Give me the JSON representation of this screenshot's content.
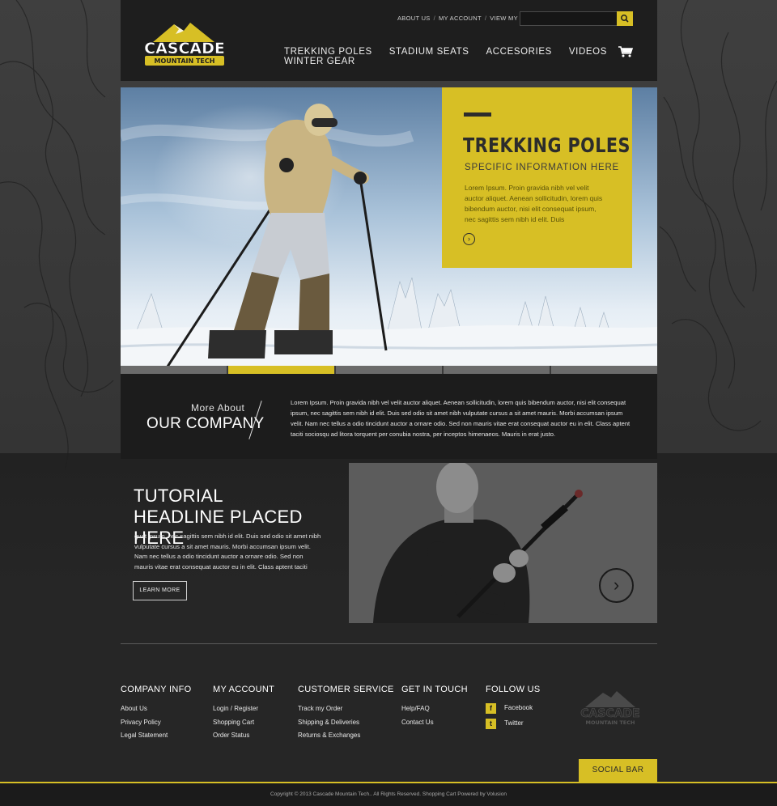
{
  "header": {
    "logo": {
      "name": "CASCADE",
      "tagline": "MOUNTAIN TECH"
    },
    "util_links": [
      "ABOUT US",
      "MY ACCOUNT",
      "VIEW MY CART"
    ],
    "search": {
      "placeholder": ""
    },
    "nav": [
      "TREKKING POLES",
      "STADIUM SEATS",
      "ACCESORIES",
      "VIDEOS",
      "WINTER GEAR"
    ],
    "cart_icon": "shopping-cart-icon",
    "search_icon": "search-icon"
  },
  "hero": {
    "title": "TREKKING POLES",
    "subtitle": "SPECIFIC INFORMATION HERE",
    "body": "Lorem Ipsum. Proin gravida nibh vel velit auctor aliquet. Aenean sollicitudin, lorem quis bibendum auctor, nisi elit consequat ipsum, nec sagittis sem nibh id elit. Duis",
    "arrow_icon": "chevron-right-icon",
    "slides": 5,
    "active_slide": 1
  },
  "about": {
    "kicker": "More About",
    "heading": "OUR COMPANY",
    "body": "Lorem Ipsum. Proin gravida nibh vel velit auctor aliquet. Aenean sollicitudin, lorem quis bibendum auctor, nisi elit consequat ipsum, nec sagittis sem nibh id elit. Duis sed odio sit amet nibh vulputate cursus a sit amet mauris. Morbi accumsan ipsum velit. Nam nec tellus a odio tincidunt auctor a ornare odio. Sed non  mauris vitae erat consequat auctor eu in elit. Class aptent taciti sociosqu ad litora torquent per conubia nostra, per inceptos himenaeos. Mauris in erat justo."
  },
  "tutorial": {
    "headline": "TUTORIAL HEADLINE PLACED HERE",
    "body": "quat ipsum, nec sagittis sem nibh id elit. Duis sed odio sit amet nibh vulputate cursus a sit amet mauris. Morbi accumsan ipsum velit. Nam nec tellus a odio tincidunt auctor a ornare odio. Sed non mauris vitae erat consequat auctor eu in elit. Class aptent taciti",
    "button": "LEARN MORE",
    "play_icon": "chevron-right-icon"
  },
  "footer": {
    "columns": [
      {
        "title": "COMPANY INFO",
        "links": [
          "About Us",
          "Privacy Policy",
          "Legal Statement"
        ]
      },
      {
        "title": "MY ACCOUNT",
        "links": [
          "Login / Register",
          "Shopping Cart",
          "Order Status"
        ]
      },
      {
        "title": "CUSTOMER SERVICE",
        "links": [
          "Track my Order",
          "Shipping & Deliveries",
          "Returns & Exchanges"
        ]
      },
      {
        "title": "GET IN TOUCH",
        "links": [
          "Help/FAQ",
          "Contact Us"
        ]
      }
    ],
    "follow": {
      "title": "FOLLOW US",
      "items": [
        {
          "label": "Facebook",
          "icon": "facebook-icon",
          "glyph": "f"
        },
        {
          "label": "Twitter",
          "icon": "twitter-icon",
          "glyph": "t"
        }
      ]
    },
    "logo": {
      "name": "CASCADE",
      "tagline": "MOUNTAIN TECH"
    },
    "social_bar": "SOCIAL BAR",
    "copyright": "Copyright © 2013 Cascade Mountain Tech.. All Rights Reserved. Shopping Cart Powered by Volusion"
  },
  "colors": {
    "accent": "#d7bf25",
    "dark": "#1e1e1e",
    "bg": "#2b2b2b"
  }
}
